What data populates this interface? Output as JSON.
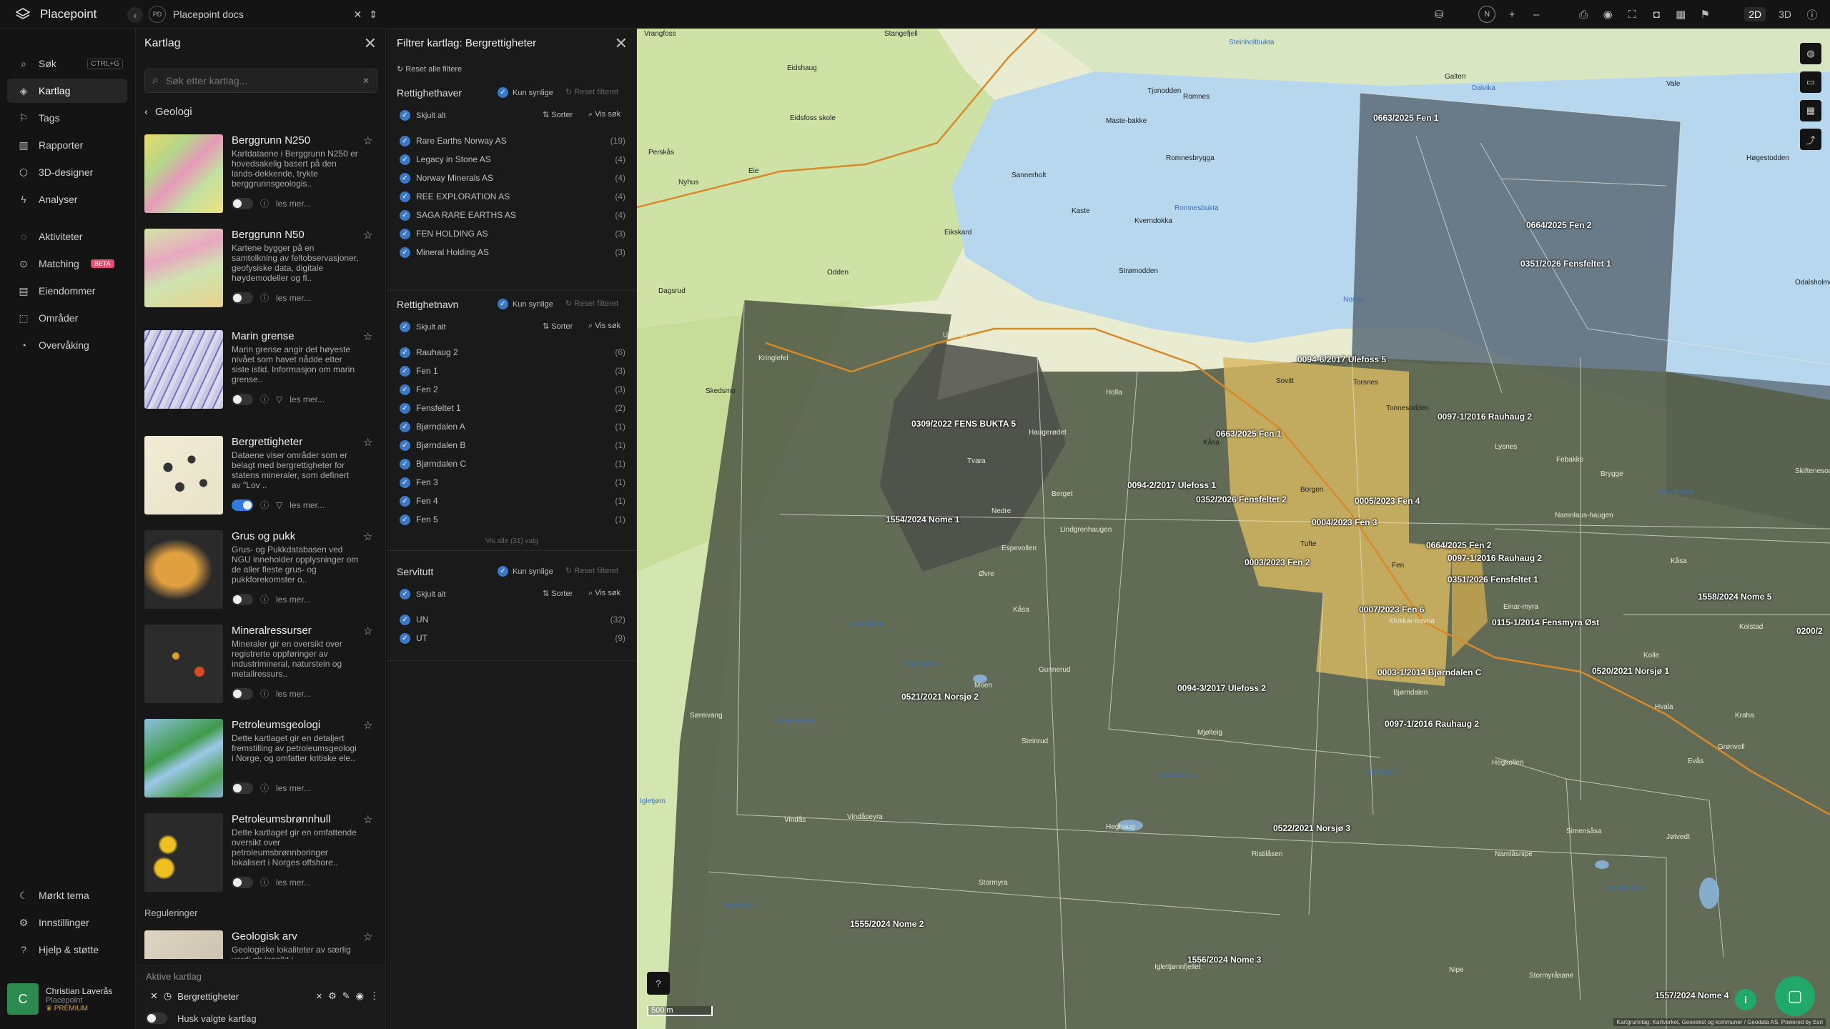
{
  "app": {
    "name": "Placepoint",
    "workspace_badge": "PD",
    "workspace": "Placepoint docs"
  },
  "toolbar": {
    "mode_2d": "2D",
    "mode_3d": "3D",
    "north": "N"
  },
  "nav": [
    {
      "label": "Søk",
      "icon": "search-icon",
      "shortcut": "CTRL+G"
    },
    {
      "label": "Kartlag",
      "icon": "layers-icon",
      "active": true
    },
    {
      "label": "Tags",
      "icon": "bookmark-icon"
    },
    {
      "label": "Rapporter",
      "icon": "bar-chart-icon"
    },
    {
      "label": "3D-designer",
      "icon": "cube-icon"
    },
    {
      "label": "Analyser",
      "icon": "lightning-icon"
    },
    {
      "label": "Aktiviteter",
      "icon": "chat-icon"
    },
    {
      "label": "Matching",
      "icon": "match-icon",
      "badge": "BETA"
    },
    {
      "label": "Eiendommer",
      "icon": "building-icon"
    },
    {
      "label": "Områder",
      "icon": "area-icon"
    },
    {
      "label": "Overvåking",
      "icon": "monitor-icon"
    }
  ],
  "nav_bottom": [
    {
      "label": "Mørkt tema",
      "icon": "moon-icon"
    },
    {
      "label": "Innstillinger",
      "icon": "gear-icon"
    },
    {
      "label": "Hjelp & støtte",
      "icon": "help-icon"
    }
  ],
  "user": {
    "initial": "C",
    "name": "Christian Laverås",
    "org": "Placepoint",
    "plan": "PREMIUM"
  },
  "layers_panel": {
    "title": "Kartlag",
    "search_placeholder": "Søk etter kartlag...",
    "back_label": "Geologi",
    "read_more": "les mer...",
    "items": [
      {
        "name": "Berggrunn N250",
        "desc": "Kartdataene i Berggrunn N250 er hovedsakelig basert på den lands-dekkende, trykte berggrunnsgeologis..",
        "enabled": false
      },
      {
        "name": "Berggrunn N50",
        "desc": "Kartene bygger på en samtolkning av feltobservasjoner, geofysiske data, digitale høydemodeller og fl..",
        "enabled": false
      },
      {
        "name": "Marin grense",
        "desc": "Marin grense angir det høyeste nivået som havet nådde etter siste istid. Informasjon om marin grense..",
        "enabled": false
      },
      {
        "name": "Bergrettigheter",
        "desc": "Dataene viser områder som er belagt med bergrettigheter for statens mineraler, som definert av \"Lov ..",
        "enabled": true
      },
      {
        "name": "Grus og pukk",
        "desc": "Grus- og Pukkdatabasen ved NGU inneholder opplysninger om de aller fleste grus- og pukkforekomster o..",
        "enabled": false
      },
      {
        "name": "Mineralressurser",
        "desc": "Mineraler gir en oversikt over registrerte oppføringer av industrimineral, naturstein og metallressurs..",
        "enabled": false
      },
      {
        "name": "Petroleumsgeologi",
        "desc": "Dette kartlaget gir en detaljert fremstilling av petroleumsgeologi i Norge, og omfatter kritiske ele..",
        "enabled": false
      },
      {
        "name": "Petroleumsbrønnhull",
        "desc": "Dette kartlaget gir en omfattende oversikt over petroleumsbrønnboringer lokalisert i Norges offshore..",
        "enabled": false
      }
    ],
    "section_regulations": "Reguleringer",
    "reg_item": {
      "name": "Geologisk arv",
      "desc": "Geologiske lokaliteter av særlig verdi gir innsikt i"
    },
    "active_title": "Aktive kartlag",
    "active_layer": "Bergrettigheter",
    "remember": "Husk valgte kartlag"
  },
  "filter_panel": {
    "title": "Filtrer kartlag: Bergrettigheter",
    "reset_all": "Reset alle filtere",
    "only_visible": "Kun synlige",
    "reset_filter": "Reset filteret",
    "hide_all": "Skjult alt",
    "sort": "Sorter",
    "show_search": "Vis søk",
    "sections": [
      {
        "title": "Rettighethaver",
        "rows": [
          {
            "label": "Rare Earths Norway AS",
            "count": "(19)"
          },
          {
            "label": "Legacy in Stone AS",
            "count": "(4)"
          },
          {
            "label": "Norway Minerals AS",
            "count": "(4)"
          },
          {
            "label": "REE EXPLORATION AS",
            "count": "(4)"
          },
          {
            "label": "SAGA RARE EARTHS AS",
            "count": "(4)"
          },
          {
            "label": "FEN HOLDING AS",
            "count": "(3)"
          },
          {
            "label": "Mineral Holding AS",
            "count": "(3)"
          }
        ]
      },
      {
        "title": "Rettighetnavn",
        "rows": [
          {
            "label": "Rauhaug 2",
            "count": "(6)"
          },
          {
            "label": "Fen 1",
            "count": "(3)"
          },
          {
            "label": "Fen 2",
            "count": "(3)"
          },
          {
            "label": "Fensfeltet 1",
            "count": "(2)"
          },
          {
            "label": "Bjørndalen A",
            "count": "(1)"
          },
          {
            "label": "Bjørndalen B",
            "count": "(1)"
          },
          {
            "label": "Bjørndalen C",
            "count": "(1)"
          },
          {
            "label": "Fen 3",
            "count": "(1)"
          },
          {
            "label": "Fen 4",
            "count": "(1)"
          },
          {
            "label": "Fen 5",
            "count": "(1)"
          }
        ],
        "show_all": "Vis alle (31) valg"
      },
      {
        "title": "Servitutt",
        "rows": [
          {
            "label": "UN",
            "count": "(32)"
          },
          {
            "label": "UT",
            "count": "(9)"
          }
        ]
      }
    ]
  },
  "map": {
    "scale": "500 m",
    "attribution": "Kartgrunnlag: Kartverket, Geovekst og kommuner / Geodata AS, Powered by Esri",
    "colors": {
      "land_light": "#e9ecd0",
      "land_green": "#c9de9e",
      "water": "#b7d7ee",
      "overlay_dark": "#56604a",
      "overlay_blue": "#5e6e7a",
      "overlay_yellow": "#d8b860",
      "road": "#d88a2a"
    },
    "parcels": [
      "0663/2025 Fen 1",
      "0664/2025 Fen 2",
      "0351/2026 Fensfeltet 1",
      "0094-6/2017 Ulefoss 5",
      "0097-1/2016 Rauhaug 2",
      "0309/2022 FENS BUKTA 5",
      "0663/2025 Fen 1",
      "0094-2/2017 Ulefoss 1",
      "0352/2026 Fensfeltet 2",
      "0005/2023 Fen 4",
      "0004/2023 Fen 3",
      "1554/2024 Nome 1",
      "0664/2025 Fen 2",
      "0097-1/2016 Rauhaug 2",
      "0003/2023 Fen 2",
      "0351/2026 Fensfeltet 1",
      "1558/2024 Nome 5",
      "0007/2023 Fen 6",
      "0115-1/2014 Fensmyra Øst",
      "0200/2",
      "0003-1/2014 Bjørndalen C",
      "0520/2021 Norsjø 1",
      "0094-3/2017 Ulefoss 2",
      "0521/2021 Norsjø 2",
      "0097-1/2016 Rauhaug 2",
      "0522/2021 Norsjø 3",
      "1555/2024 Nome 2",
      "1556/2024 Nome 3",
      "1557/2024 Nome 4"
    ],
    "places": [
      "Vrangfoss",
      "Stangefjell",
      "Eidshaug",
      "Steinholtbukta",
      "Galten",
      "Dalvika",
      "Vale",
      "Romnes",
      "Tjonodden",
      "Maste-bakke",
      "Romnesbrygga",
      "Perskås",
      "Eidsfoss skole",
      "Eie",
      "Nyhus",
      "Sannerholt",
      "Kaste",
      "Kverndokka",
      "Romnesbukta",
      "Høgestodden",
      "Eikskard",
      "Odden",
      "Strømodden",
      "Dagsrud",
      "Norsjø",
      "Kringlefel",
      "Ulefoss",
      "Skedsmo",
      "Holla",
      "Sovitt",
      "Torsnes",
      "Tonnesodden",
      "Haugerødet",
      "Tvara",
      "Kåsa",
      "Berget",
      "Borgen",
      "Lindgrenhaugen",
      "Nedre",
      "Espevollen",
      "Øvre",
      "Tufte",
      "Fen",
      "Kåsa",
      "Tvaratjønn",
      "Damtjønn",
      "Moen",
      "Gunnerud",
      "Nukebekken",
      "Søreivang",
      "Mjølteig",
      "Bjørndalen",
      "Steinrud",
      "Hegkollen",
      "Heghaug",
      "Hæmtjønn",
      "Damtjønn",
      "Vindås",
      "Vindåseyra",
      "Ristilåsen",
      "Stormyra",
      "Namlåsnipe",
      "Igletjørn",
      "Hollatjørn",
      "Iglettjønnfjellet",
      "Nipe",
      "Stormyråsane",
      "Lysnes",
      "Febakke",
      "Nordbukta",
      "Kolstad",
      "Kolle",
      "Hvala",
      "Grønvoll",
      "Evås",
      "Simensåsa",
      "Jøtvedt",
      "Storbekken",
      "Skiftenesodden",
      "Odalsholmen",
      "Hoge",
      "Kraha",
      "Namnlaus-haugen",
      "Kåsa",
      "Brygge",
      "Einar-myra",
      "Klokkar-havna"
    ]
  }
}
